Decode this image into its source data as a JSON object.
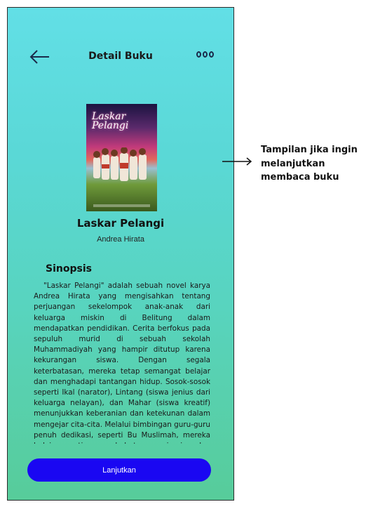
{
  "header": {
    "title": "Detail Buku"
  },
  "icons": {
    "back": "arrow-left-icon",
    "more": "more-dots-icon"
  },
  "book": {
    "cover_title": "Laskar Pelangi",
    "title": "Laskar Pelangi",
    "author": "Andrea Hirata"
  },
  "synopsis": {
    "heading": "Sinopsis",
    "text": "\"Laskar Pelangi\" adalah sebuah novel karya Andrea Hirata yang mengisahkan tentang perjuangan sekelompok anak-anak dari keluarga miskin di Belitung dalam mendapatkan pendidikan. Cerita berfokus pada sepuluh murid di sebuah sekolah Muhammadiyah yang hampir ditutup karena kekurangan siswa. Dengan segala keterbatasan, mereka tetap semangat belajar dan menghadapi tantangan hidup. Sosok-sosok seperti Ikal (narator), Lintang (siswa jenius dari keluarga nelayan), dan Mahar (siswa kreatif) menunjukkan keberanian dan ketekunan dalam mengejar cita-cita. Melalui bimbingan guru-guru penuh dedikasi, seperti Bu Muslimah, mereka belajar arti persahabatan, mimpi, dan semangat pantang menyerah."
  },
  "actions": {
    "continue_label": "Lanjutkan"
  },
  "annotation": {
    "text": "Tampilan jika ingin melanjutkan membaca buku"
  },
  "colors": {
    "gradient_top": "#62dfe6",
    "gradient_bottom": "#57cc9a",
    "button": "#1a07f2",
    "button_text": "#ffffff"
  }
}
